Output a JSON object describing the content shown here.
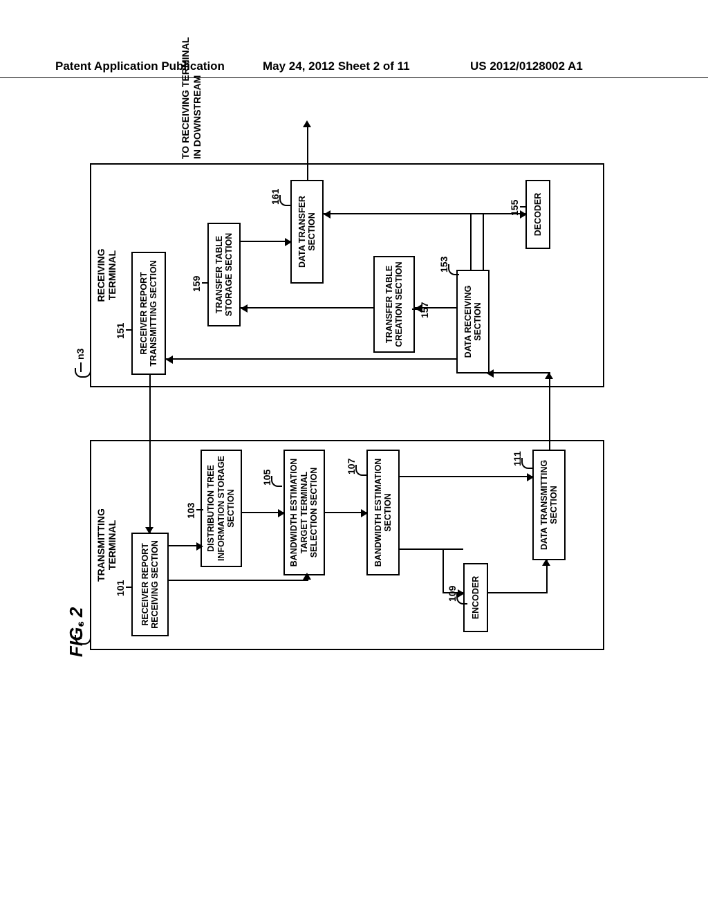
{
  "page_header": {
    "left": "Patent Application Publication",
    "center": "May 24, 2012  Sheet 2 of 11",
    "right": "US 2012/0128002 A1"
  },
  "figure_label": "FIG. 2",
  "external_label": "TO RECEIVING TERMINAL\nIN DOWNSTREAM",
  "transmitting": {
    "tag": "s",
    "title": "TRANSMITTING\nTERMINAL",
    "blocks": {
      "b101": {
        "ref": "101",
        "label": "RECEIVER REPORT\nRECEIVING SECTION"
      },
      "b103": {
        "ref": "103",
        "label": "DISTRIBUTION TREE\nINFORMATION\nSTORAGE SECTION"
      },
      "b105": {
        "ref": "105",
        "label": "BANDWIDTH ESTIMATION\nTARGET TERMINAL\nSELECTION SECTION"
      },
      "b107": {
        "ref": "107",
        "label": "BANDWIDTH ESTIMATION\nSECTION"
      },
      "b109": {
        "ref": "109",
        "label": "ENCODER"
      },
      "b111": {
        "ref": "111",
        "label": "DATA TRANSMITTING\nSECTION"
      }
    }
  },
  "receiving": {
    "tag": "n3",
    "title": "RECEIVING\nTERMINAL",
    "blocks": {
      "b151": {
        "ref": "151",
        "label": "RECEIVER REPORT\nTRANSMITTING SECTION"
      },
      "b153": {
        "ref": "153",
        "label": "DATA RECEIVING\nSECTION"
      },
      "b155": {
        "ref": "155",
        "label": "DECODER"
      },
      "b157": {
        "ref": "157",
        "label": "TRANSFER TABLE\nCREATION\nSECTION"
      },
      "b159": {
        "ref": "159",
        "label": "TRANSFER TABLE\nSTORAGE SECTION"
      },
      "b161": {
        "ref": "161",
        "label": "DATA TRANSFER\nSECTION"
      }
    }
  },
  "chart_data": {
    "type": "diagram",
    "nodes": [
      {
        "id": "s",
        "label": "TRANSMITTING TERMINAL"
      },
      {
        "id": "101",
        "label": "RECEIVER REPORT RECEIVING SECTION",
        "parent": "s"
      },
      {
        "id": "103",
        "label": "DISTRIBUTION TREE INFORMATION STORAGE SECTION",
        "parent": "s"
      },
      {
        "id": "105",
        "label": "BANDWIDTH ESTIMATION TARGET TERMINAL SELECTION SECTION",
        "parent": "s"
      },
      {
        "id": "107",
        "label": "BANDWIDTH ESTIMATION SECTION",
        "parent": "s"
      },
      {
        "id": "109",
        "label": "ENCODER",
        "parent": "s"
      },
      {
        "id": "111",
        "label": "DATA TRANSMITTING SECTION",
        "parent": "s"
      },
      {
        "id": "n3",
        "label": "RECEIVING TERMINAL"
      },
      {
        "id": "151",
        "label": "RECEIVER REPORT TRANSMITTING SECTION",
        "parent": "n3"
      },
      {
        "id": "153",
        "label": "DATA RECEIVING SECTION",
        "parent": "n3"
      },
      {
        "id": "155",
        "label": "DECODER",
        "parent": "n3"
      },
      {
        "id": "157",
        "label": "TRANSFER TABLE CREATION SECTION",
        "parent": "n3"
      },
      {
        "id": "159",
        "label": "TRANSFER TABLE STORAGE SECTION",
        "parent": "n3"
      },
      {
        "id": "161",
        "label": "DATA TRANSFER SECTION",
        "parent": "n3"
      },
      {
        "id": "downstream",
        "label": "TO RECEIVING TERMINAL IN DOWNSTREAM"
      }
    ],
    "edges": [
      {
        "from": "101",
        "to": "103"
      },
      {
        "from": "101",
        "to": "105"
      },
      {
        "from": "103",
        "to": "105"
      },
      {
        "from": "105",
        "to": "107"
      },
      {
        "from": "107",
        "to": "109"
      },
      {
        "from": "107",
        "to": "111"
      },
      {
        "from": "109",
        "to": "111"
      },
      {
        "from": "111",
        "to": "153"
      },
      {
        "from": "151",
        "to": "101"
      },
      {
        "from": "153",
        "to": "151"
      },
      {
        "from": "153",
        "to": "155"
      },
      {
        "from": "153",
        "to": "157"
      },
      {
        "from": "153",
        "to": "161"
      },
      {
        "from": "157",
        "to": "159"
      },
      {
        "from": "159",
        "to": "161"
      },
      {
        "from": "161",
        "to": "downstream"
      }
    ]
  }
}
